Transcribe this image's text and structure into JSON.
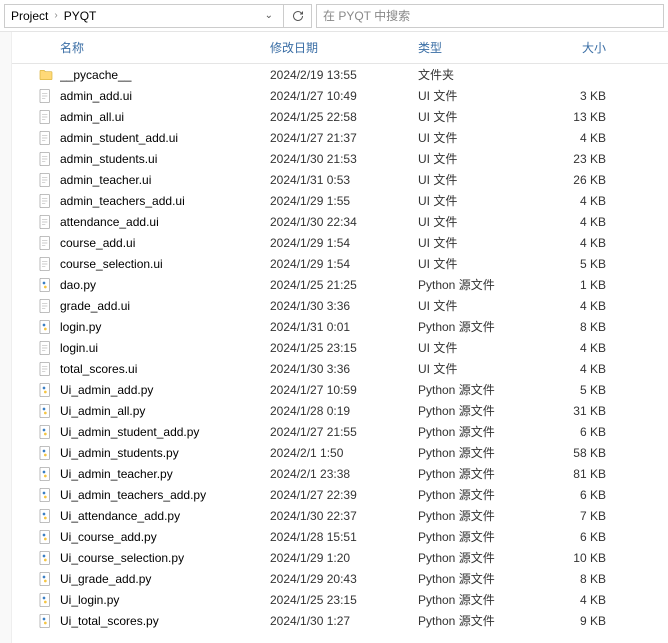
{
  "breadcrumb": {
    "parent": "Project",
    "current": "PYQT"
  },
  "search_placeholder": "在 PYQT 中搜索",
  "columns": {
    "name": "名称",
    "date": "修改日期",
    "type": "类型",
    "size": "大小"
  },
  "type_labels": {
    "folder": "文件夹",
    "ui": "UI 文件",
    "py": "Python 源文件"
  },
  "files": [
    {
      "name": "__pycache__",
      "date": "2024/2/19 13:55",
      "kind": "folder",
      "size": ""
    },
    {
      "name": "admin_add.ui",
      "date": "2024/1/27 10:49",
      "kind": "ui",
      "size": "3 KB"
    },
    {
      "name": "admin_all.ui",
      "date": "2024/1/25 22:58",
      "kind": "ui",
      "size": "13 KB"
    },
    {
      "name": "admin_student_add.ui",
      "date": "2024/1/27 21:37",
      "kind": "ui",
      "size": "4 KB"
    },
    {
      "name": "admin_students.ui",
      "date": "2024/1/30 21:53",
      "kind": "ui",
      "size": "23 KB"
    },
    {
      "name": "admin_teacher.ui",
      "date": "2024/1/31 0:53",
      "kind": "ui",
      "size": "26 KB"
    },
    {
      "name": "admin_teachers_add.ui",
      "date": "2024/1/29 1:55",
      "kind": "ui",
      "size": "4 KB"
    },
    {
      "name": "attendance_add.ui",
      "date": "2024/1/30 22:34",
      "kind": "ui",
      "size": "4 KB"
    },
    {
      "name": "course_add.ui",
      "date": "2024/1/29 1:54",
      "kind": "ui",
      "size": "4 KB"
    },
    {
      "name": "course_selection.ui",
      "date": "2024/1/29 1:54",
      "kind": "ui",
      "size": "5 KB"
    },
    {
      "name": "dao.py",
      "date": "2024/1/25 21:25",
      "kind": "py",
      "size": "1 KB"
    },
    {
      "name": "grade_add.ui",
      "date": "2024/1/30 3:36",
      "kind": "ui",
      "size": "4 KB"
    },
    {
      "name": "login.py",
      "date": "2024/1/31 0:01",
      "kind": "py",
      "size": "8 KB"
    },
    {
      "name": "login.ui",
      "date": "2024/1/25 23:15",
      "kind": "ui",
      "size": "4 KB"
    },
    {
      "name": "total_scores.ui",
      "date": "2024/1/30 3:36",
      "kind": "ui",
      "size": "4 KB"
    },
    {
      "name": "Ui_admin_add.py",
      "date": "2024/1/27 10:59",
      "kind": "py",
      "size": "5 KB"
    },
    {
      "name": "Ui_admin_all.py",
      "date": "2024/1/28 0:19",
      "kind": "py",
      "size": "31 KB"
    },
    {
      "name": "Ui_admin_student_add.py",
      "date": "2024/1/27 21:55",
      "kind": "py",
      "size": "6 KB"
    },
    {
      "name": "Ui_admin_students.py",
      "date": "2024/2/1 1:50",
      "kind": "py",
      "size": "58 KB"
    },
    {
      "name": "Ui_admin_teacher.py",
      "date": "2024/2/1 23:38",
      "kind": "py",
      "size": "81 KB"
    },
    {
      "name": "Ui_admin_teachers_add.py",
      "date": "2024/1/27 22:39",
      "kind": "py",
      "size": "6 KB"
    },
    {
      "name": "Ui_attendance_add.py",
      "date": "2024/1/30 22:37",
      "kind": "py",
      "size": "7 KB"
    },
    {
      "name": "Ui_course_add.py",
      "date": "2024/1/28 15:51",
      "kind": "py",
      "size": "6 KB"
    },
    {
      "name": "Ui_course_selection.py",
      "date": "2024/1/29 1:20",
      "kind": "py",
      "size": "10 KB"
    },
    {
      "name": "Ui_grade_add.py",
      "date": "2024/1/29 20:43",
      "kind": "py",
      "size": "8 KB"
    },
    {
      "name": "Ui_login.py",
      "date": "2024/1/25 23:15",
      "kind": "py",
      "size": "4 KB"
    },
    {
      "name": "Ui_total_scores.py",
      "date": "2024/1/30 1:27",
      "kind": "py",
      "size": "9 KB"
    }
  ]
}
